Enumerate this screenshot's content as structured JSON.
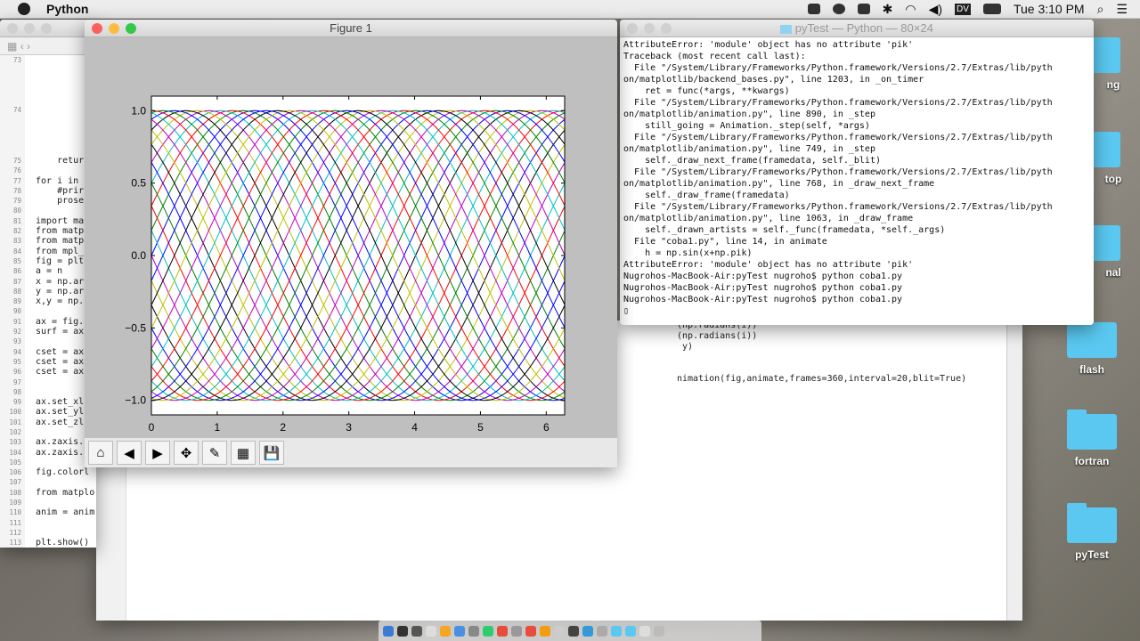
{
  "menubar": {
    "app_name": "Python",
    "clock": "Tue 3:10 PM",
    "icons": [
      "coffee-icon",
      "record-icon",
      "dropbox-icon",
      "bluetooth-icon",
      "wifi-icon",
      "volume-icon",
      "dv-icon",
      "battery-icon",
      "search-icon",
      "list-icon"
    ],
    "dv_label": "DV"
  },
  "editor": {
    "line_numbers": [
      "73",
      "",
      "",
      "",
      "",
      "74",
      "",
      "",
      "",
      "",
      "75",
      "76",
      "77",
      "78",
      "79",
      "80",
      "81",
      "82",
      "83",
      "84",
      "85",
      "86",
      "87",
      "88",
      "89",
      "90",
      "91",
      "92",
      "93",
      "94",
      "95",
      "96",
      "97",
      "98",
      "99",
      "100",
      "101",
      "102",
      "103",
      "104",
      "105",
      "106",
      "107",
      "108",
      "109",
      "110",
      "111",
      "112",
      "113"
    ],
    "lines": [
      "",
      "",
      "",
      "",
      "",
      "",
      "",
      "",
      "",
      "",
      "    retur",
      "",
      "for i in ",
      "    #prir",
      "    prose",
      "",
      "import ma",
      "from matp",
      "from matp",
      "from mpl_",
      "fig = plt",
      "a = n",
      "x = np.ar",
      "y = np.ar",
      "x,y = np.",
      "",
      "ax = fig.",
      "surf = ax",
      "",
      "cset = ax",
      "cset = ax",
      "cset = ax",
      "",
      "",
      "ax.set_xl",
      "ax.set_yl",
      "ax.set_zl",
      "",
      "ax.zaxis.",
      "ax.zaxis.",
      "",
      "fig.colorl",
      "",
      "from matplo",
      "",
      "anim = anim",
      "",
      "",
      "plt.show()"
    ]
  },
  "back_editor": {
    "lines": [
      "(np.radians(i))",
      "(np.radians(i))",
      " y)",
      "",
      "",
      "nimation(fig,animate,frames=360,interval=20,blit=True)"
    ]
  },
  "terminal": {
    "title": "pyTest — Python — 80×24",
    "text": "AttributeError: 'module' object has no attribute 'pik'\nTraceback (most recent call last):\n  File \"/System/Library/Frameworks/Python.framework/Versions/2.7/Extras/lib/pyth\non/matplotlib/backend_bases.py\", line 1203, in _on_timer\n    ret = func(*args, **kwargs)\n  File \"/System/Library/Frameworks/Python.framework/Versions/2.7/Extras/lib/pyth\non/matplotlib/animation.py\", line 890, in _step\n    still_going = Animation._step(self, *args)\n  File \"/System/Library/Frameworks/Python.framework/Versions/2.7/Extras/lib/pyth\non/matplotlib/animation.py\", line 749, in _step\n    self._draw_next_frame(framedata, self._blit)\n  File \"/System/Library/Frameworks/Python.framework/Versions/2.7/Extras/lib/pyth\non/matplotlib/animation.py\", line 768, in _draw_next_frame\n    self._draw_frame(framedata)\n  File \"/System/Library/Frameworks/Python.framework/Versions/2.7/Extras/lib/pyth\non/matplotlib/animation.py\", line 1063, in _draw_frame\n    self._drawn_artists = self._func(framedata, *self._args)\n  File \"coba1.py\", line 14, in animate\n    h = np.sin(x+np.pik)\nAttributeError: 'module' object has no attribute 'pik'\nNugrohos-MacBook-Air:pyTest nugroho$ python coba1.py\nNugrohos-MacBook-Air:pyTest nugroho$ python coba1.py\nNugrohos-MacBook-Air:pyTest nugroho$ python coba1.py\n▯"
  },
  "figure": {
    "title": "Figure 1",
    "toolbar": [
      {
        "name": "home-button",
        "glyph": "⌂"
      },
      {
        "name": "back-button",
        "glyph": "◀"
      },
      {
        "name": "forward-button",
        "glyph": "▶"
      },
      {
        "name": "pan-button",
        "glyph": "✥"
      },
      {
        "name": "zoom-button",
        "glyph": "✎"
      },
      {
        "name": "subplots-button",
        "glyph": "▦"
      },
      {
        "name": "save-button",
        "glyph": "💾"
      }
    ]
  },
  "chart_data": {
    "type": "line",
    "title": "",
    "xlabel": "",
    "ylabel": "",
    "function": "sin(x + phase)",
    "x_range": [
      0,
      6.28
    ],
    "xlim": [
      0,
      6.28
    ],
    "ylim": [
      -1.1,
      1.1
    ],
    "xticks": [
      "0",
      "1",
      "2",
      "3",
      "4",
      "5",
      "6"
    ],
    "yticks": [
      "1.0",
      "0.5",
      "0.0",
      "−0.5",
      "−1.0"
    ],
    "ytick_values": [
      1,
      0.5,
      0,
      -0.5,
      -1
    ],
    "phases_deg": [
      0,
      10,
      20,
      30,
      40,
      50,
      60,
      70,
      80,
      90,
      100,
      110,
      120,
      130,
      140,
      150,
      160,
      170,
      180,
      190,
      200,
      210,
      220,
      230,
      240,
      250,
      260,
      270,
      280,
      290,
      300,
      310,
      320,
      330,
      340,
      350
    ],
    "colors": [
      "#0000ff",
      "#008000",
      "#ff0000",
      "#00bfbf",
      "#bf00bf",
      "#bfbf00",
      "#000000"
    ],
    "grid": false
  },
  "desktop": {
    "folders": [
      "ng",
      "top",
      "nal",
      "flash",
      "fortran",
      "pyTest"
    ]
  }
}
